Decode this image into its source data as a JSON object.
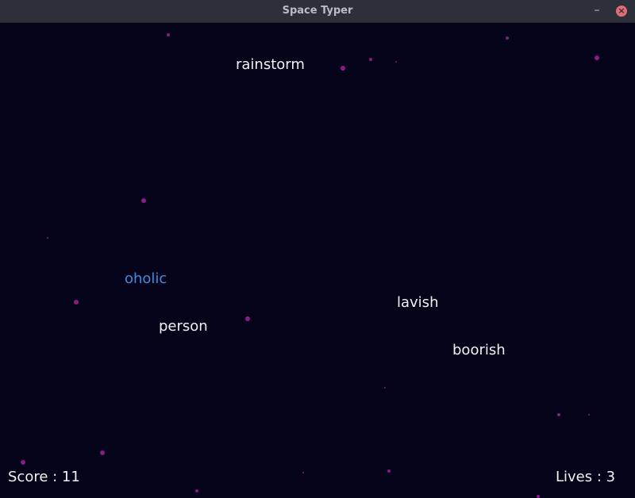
{
  "window": {
    "title": "Space Typer",
    "minimize_glyph": "–",
    "close_glyph": "×",
    "close_color": "#e06c75"
  },
  "game": {
    "background_color": "#05031a",
    "star_color": "#8a1a86",
    "active_word_color": "#3a8fe0",
    "word_color": "#f1f1f4",
    "words": [
      {
        "text": "rainstorm",
        "active": false
      },
      {
        "text": "oholic",
        "active": true
      },
      {
        "text": "lavish",
        "active": false
      },
      {
        "text": "person",
        "active": false
      },
      {
        "text": "boorish",
        "active": false
      }
    ],
    "hud": {
      "score_text": "Score : 11",
      "lives_text": "Lives : 3"
    }
  }
}
